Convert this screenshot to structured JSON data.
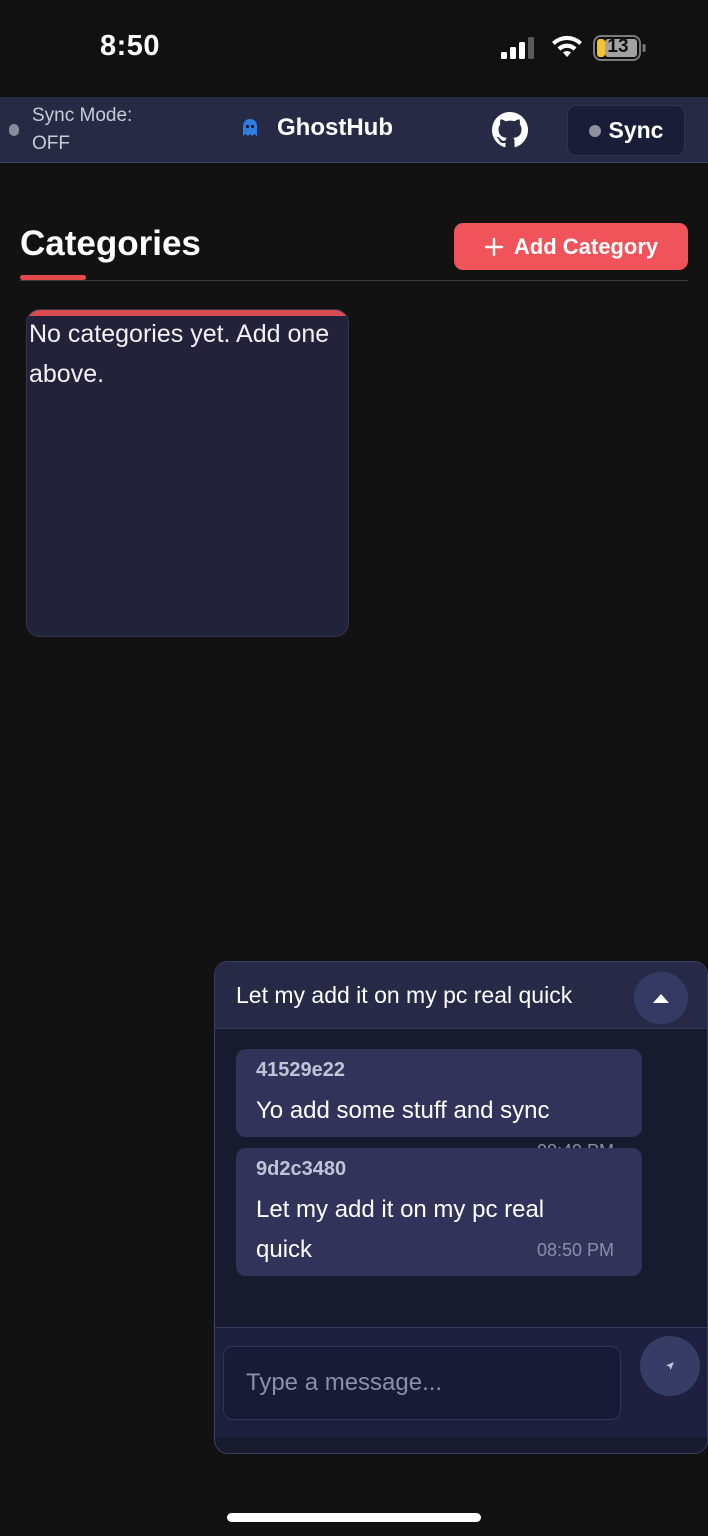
{
  "status_bar": {
    "time": "8:50",
    "battery_level": "13",
    "icons": [
      "cellular-signal-icon",
      "wifi-icon",
      "battery-icon"
    ]
  },
  "header": {
    "sync_mode": "Sync Mode: OFF",
    "app_title": "GhostHub",
    "sync_button_label": "Sync",
    "icons": [
      "ghost-icon",
      "github-icon"
    ]
  },
  "categories": {
    "title": "Categories",
    "add_button_label": "Add Category",
    "empty_message": "No categories yet. Add one above."
  },
  "chat": {
    "latest_message_preview": "Let my add it on my pc real quick",
    "messages": [
      {
        "user": "41529e22",
        "text": "Yo add some stuff and sync",
        "time": "08:49 PM"
      },
      {
        "user": "9d2c3480",
        "text": "Let my add it on my pc real quick",
        "time": "08:50 PM"
      }
    ],
    "input_placeholder": "Type a message..."
  },
  "colors": {
    "background": "#121212",
    "header": "#262a45",
    "accent_red": "#f0535a",
    "message_bubble": "#31335a",
    "chat_panel": "#181a2e"
  }
}
